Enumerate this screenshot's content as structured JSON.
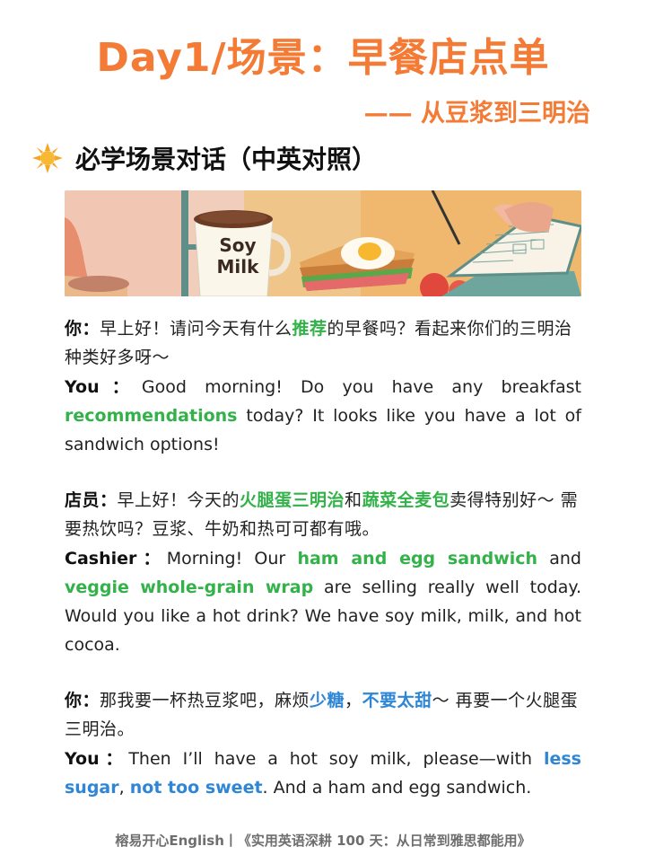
{
  "title": "Day1/场景：早餐店点单",
  "subtitle": "—— 从豆浆到三明治",
  "section_title": "必学场景对话（中英对照）",
  "banner": {
    "cup_text_line1": "Soy",
    "cup_text_line2": "Milk"
  },
  "dialog1": {
    "zh_speaker": "你：",
    "zh_a": "早上好！请问今天有什么",
    "zh_hl": "推荐",
    "zh_b": "的早餐吗？看起来你们的三明治种类好多呀～",
    "en_speaker": "You：",
    "en_a": "Good morning! Do you have any breakfast ",
    "en_hl": "recommendations",
    "en_b": " today? It looks like you have a lot of sandwich options!"
  },
  "dialog2": {
    "zh_speaker": "店员：",
    "zh_a": "早上好！今天的",
    "zh_hl1": "火腿蛋三明治",
    "zh_mid": "和",
    "zh_hl2": "蔬菜全麦包",
    "zh_b": "卖得特别好～ 需要热饮吗？豆浆、牛奶和热可可都有哦。",
    "en_speaker": "Cashier：",
    "en_a": "Morning! Our ",
    "en_hl1": "ham and egg sandwich",
    "en_mid": " and ",
    "en_hl2": "veggie whole-grain wrap",
    "en_b": " are selling really well today. Would you like a hot drink? We have soy milk, milk, and hot cocoa."
  },
  "dialog3": {
    "zh_speaker": "你：",
    "zh_a": "那我要一杯热豆浆吧，麻烦",
    "zh_hl1": "少糖",
    "zh_mid": "，",
    "zh_hl2": "不要太甜",
    "zh_b": "～ 再要一个火腿蛋三明治。",
    "en_speaker": "You：",
    "en_a": "Then I’ll have a hot soy milk, please—with ",
    "en_hl1": "less sugar",
    "en_mid": ", ",
    "en_hl2": "not too sweet",
    "en_b": ". And a ham and egg sandwich."
  },
  "footer": "榕易开心English丨《实用英语深耕 100 天：从日常到雅思都能用》",
  "colors": {
    "title": "#f37b35",
    "green_highlight": "#33b24a",
    "blue_highlight": "#2e86d6"
  }
}
